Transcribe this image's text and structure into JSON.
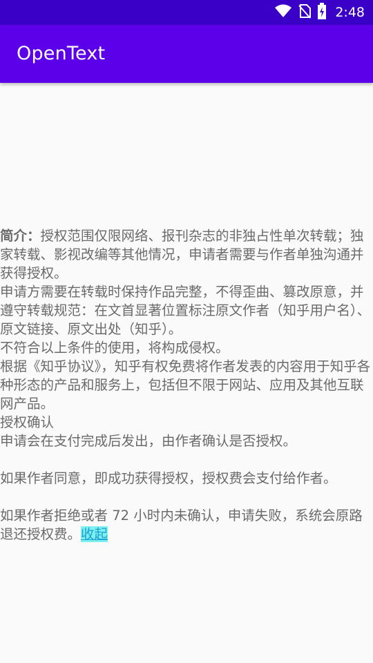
{
  "status_bar": {
    "time": "2:48",
    "icons": [
      "wifi-icon",
      "no-sim-icon",
      "battery-charging-icon"
    ]
  },
  "app_bar": {
    "title": "OpenText"
  },
  "content": {
    "intro_label": "简介：",
    "intro_text": "授权范围仅限网络、报刊杂志的非独占性单次转载；独家转载、影视改编等其他情况，申请者需要与作者单独沟通并获得授权。",
    "para2": "申请方需要在转载时保持作品完整，不得歪曲、篡改原意，并遵守转载规范：在文首显著位置标注原文作者（知乎用户名）、原文链接、原文出处（知乎）。",
    "para3": "不符合以上条件的使用，将构成侵权。",
    "para4_prefix": "根据",
    "para4_link": "《知乎协议》，",
    "para4_rest": "知乎有权免费将作者发表的内容用于知乎各种形态的产品和服务上，包括但不限于网站、应用及其他互联网产品。",
    "section_title": "授权确认",
    "para5": "申请会在支付完成后发出，由作者确认是否授权。",
    "para6": "如果作者同意，即成功获得授权，授权费会支付给作者。",
    "para7": "如果作者拒绝或者 72 小时内未确认，申请失败，系统会原路退还授权费。",
    "collapse_label": "收起"
  },
  "colors": {
    "status_bar": "#3a00c8",
    "app_bar": "#5c00ea",
    "text": "#6a6a6a",
    "link_highlight": "#7ff0f0"
  }
}
